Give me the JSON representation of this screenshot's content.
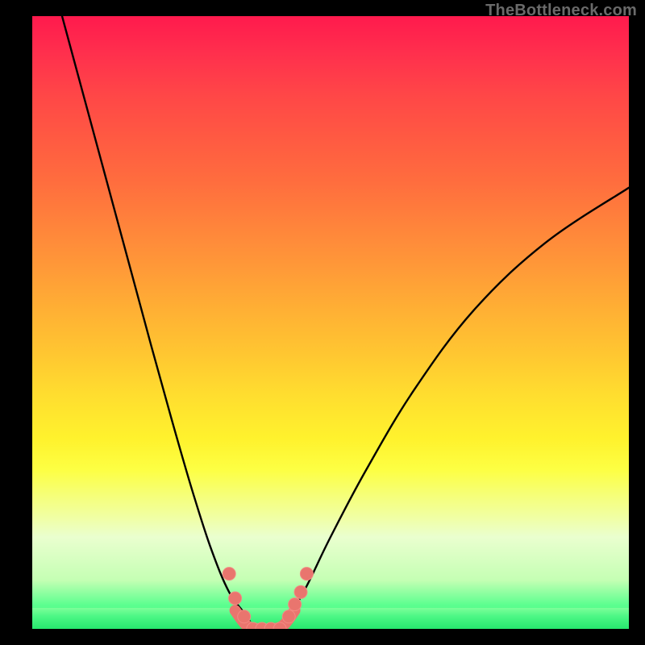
{
  "watermark": "TheBottleneck.com",
  "colors": {
    "background": "#000000",
    "curve": "#000000",
    "marker": "#e9756e",
    "gradient_top": "#ff1a4d",
    "gradient_bottom": "#27e86e"
  },
  "chart_data": {
    "type": "line",
    "title": "",
    "xlabel": "",
    "ylabel": "",
    "xlim": [
      0,
      100
    ],
    "ylim": [
      0,
      100
    ],
    "grid": false,
    "series": [
      {
        "name": "left-curve",
        "x": [
          5,
          10,
          15,
          20,
          24,
          27,
          30,
          33,
          36,
          37
        ],
        "y": [
          100,
          82,
          64,
          46,
          32,
          22,
          13,
          6,
          2,
          0
        ]
      },
      {
        "name": "right-curve",
        "x": [
          41,
          43,
          46,
          50,
          56,
          64,
          74,
          86,
          100
        ],
        "y": [
          0,
          2,
          7,
          15,
          26,
          39,
          52,
          63,
          72
        ]
      }
    ],
    "markers": {
      "name": "bottleneck-points",
      "x": [
        33,
        34,
        35.5,
        37,
        38.5,
        40,
        41.5,
        43,
        44,
        45,
        46
      ],
      "y": [
        9,
        5,
        2,
        0,
        0,
        0,
        0,
        2,
        4,
        6,
        9
      ]
    },
    "valley_stroke": {
      "x": [
        34,
        36,
        38,
        40,
        42,
        44
      ],
      "y": [
        3,
        0.5,
        0,
        0,
        0.5,
        3
      ]
    }
  }
}
